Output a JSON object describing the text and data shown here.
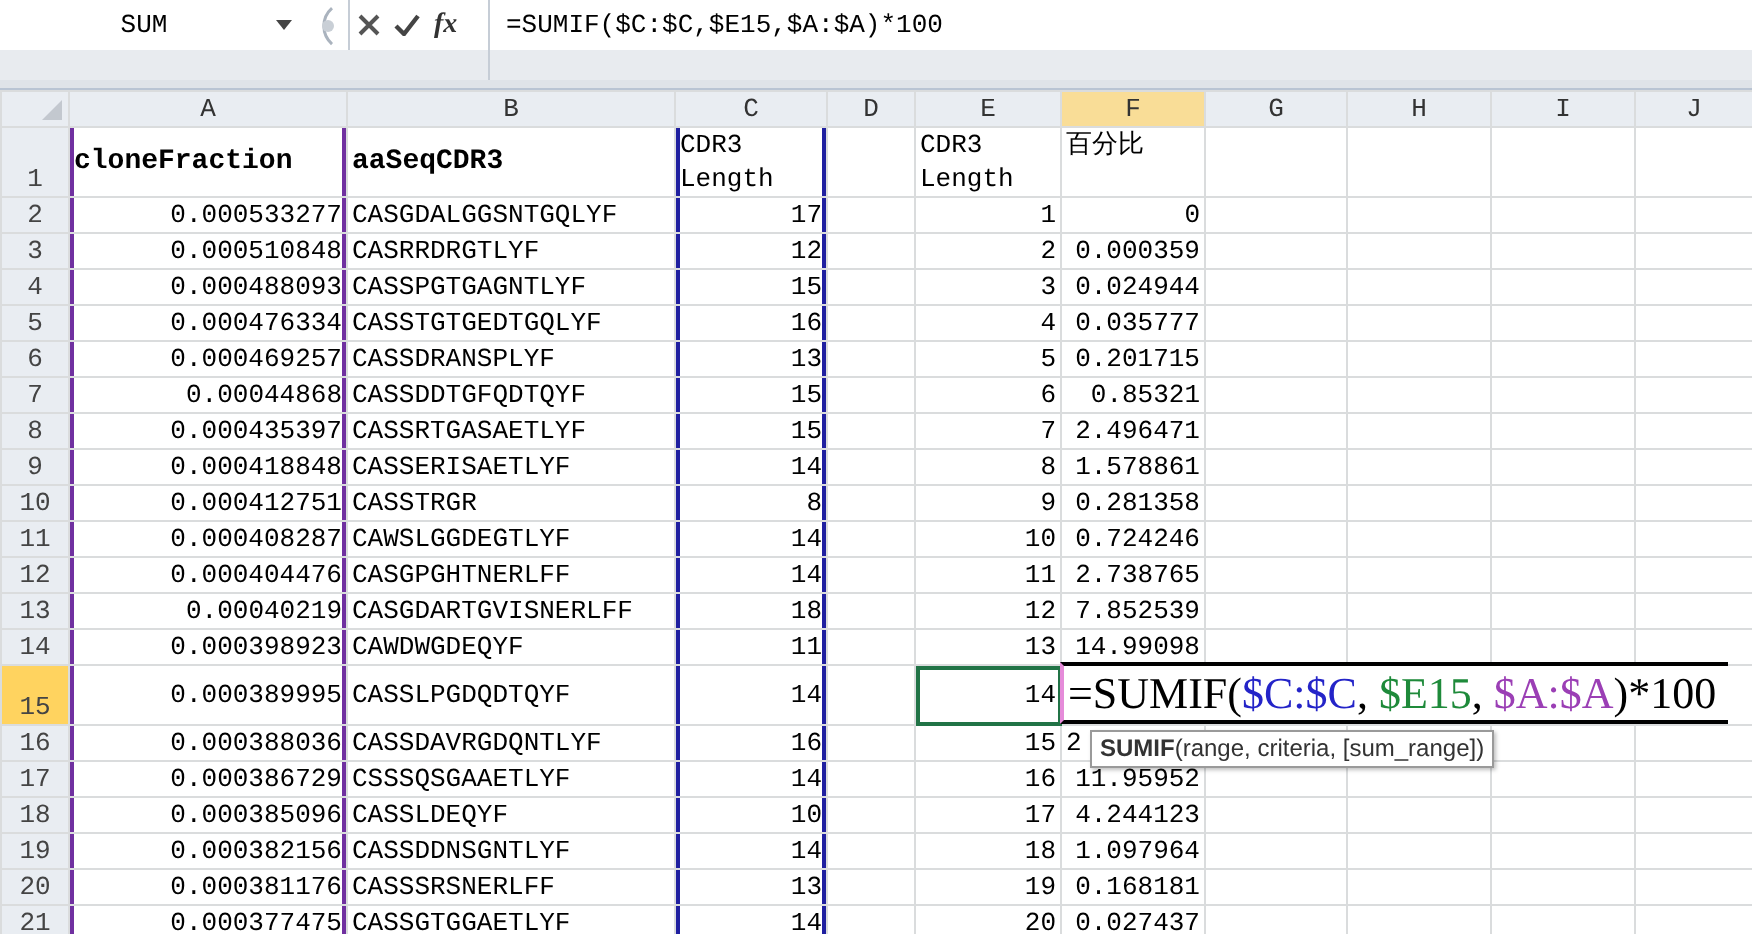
{
  "formula_bar": {
    "name_box": "SUM",
    "function_label": "fx",
    "formula": "=SUMIF($C:$C,$E15,$A:$A)*100"
  },
  "columns": [
    {
      "label": "A",
      "selected": false,
      "color": "#7030a0"
    },
    {
      "label": "B",
      "selected": false
    },
    {
      "label": "C",
      "selected": false,
      "color": "#1f1fa0"
    },
    {
      "label": "D",
      "selected": false
    },
    {
      "label": "E",
      "selected": false
    },
    {
      "label": "F",
      "selected": true
    },
    {
      "label": "G",
      "selected": false
    },
    {
      "label": "H",
      "selected": false
    },
    {
      "label": "I",
      "selected": false
    },
    {
      "label": "J",
      "selected": false
    }
  ],
  "rows": [
    {
      "number": "1",
      "selected": false,
      "cells": [
        {
          "kind": "bold",
          "text": "cloneFraction",
          "selected": false
        },
        {
          "kind": "bold",
          "text": "aaSeqCDR3",
          "selected": false
        },
        {
          "kind": "wrap",
          "text": "CDR3 Length",
          "selected": false
        },
        {
          "kind": "wrap",
          "text": "CDR3 Length",
          "selected": false
        },
        {
          "kind": "wrap",
          "text": "百分比",
          "selected": false
        }
      ]
    },
    {
      "number": "2",
      "selected": false,
      "cells": [
        {
          "kind": "number",
          "text": "0.000533277",
          "selected": false
        },
        {
          "kind": "text",
          "text": "CASGDALGGSNTGQLYF",
          "selected": false
        },
        {
          "kind": "number",
          "text": "17",
          "selected": false
        },
        {
          "kind": "number",
          "text": "1",
          "selected": false
        },
        {
          "kind": "number",
          "text": "0",
          "selected": false
        }
      ]
    },
    {
      "number": "3",
      "selected": false,
      "cells": [
        {
          "kind": "number",
          "text": "0.000510848",
          "selected": false
        },
        {
          "kind": "text",
          "text": "CASRRDRGTLYF",
          "selected": false
        },
        {
          "kind": "number",
          "text": "12",
          "selected": false
        },
        {
          "kind": "number",
          "text": "2",
          "selected": false
        },
        {
          "kind": "number",
          "text": "0.000359",
          "selected": false
        }
      ]
    },
    {
      "number": "4",
      "selected": false,
      "cells": [
        {
          "kind": "number",
          "text": "0.000488093",
          "selected": false
        },
        {
          "kind": "text",
          "text": "CASSPGTGAGNTLYF",
          "selected": false
        },
        {
          "kind": "number",
          "text": "15",
          "selected": false
        },
        {
          "kind": "number",
          "text": "3",
          "selected": false
        },
        {
          "kind": "number",
          "text": "0.024944",
          "selected": false
        }
      ]
    },
    {
      "number": "5",
      "selected": false,
      "cells": [
        {
          "kind": "number",
          "text": "0.000476334",
          "selected": false
        },
        {
          "kind": "text",
          "text": "CASSTGTGEDTGQLYF",
          "selected": false
        },
        {
          "kind": "number",
          "text": "16",
          "selected": false
        },
        {
          "kind": "number",
          "text": "4",
          "selected": false
        },
        {
          "kind": "number",
          "text": "0.035777",
          "selected": false
        }
      ]
    },
    {
      "number": "6",
      "selected": false,
      "cells": [
        {
          "kind": "number",
          "text": "0.000469257",
          "selected": false
        },
        {
          "kind": "text",
          "text": "CASSDRANSPLYF",
          "selected": false
        },
        {
          "kind": "number",
          "text": "13",
          "selected": false
        },
        {
          "kind": "number",
          "text": "5",
          "selected": false
        },
        {
          "kind": "number",
          "text": "0.201715",
          "selected": false
        }
      ]
    },
    {
      "number": "7",
      "selected": false,
      "cells": [
        {
          "kind": "number",
          "text": "0.00044868",
          "selected": false
        },
        {
          "kind": "text",
          "text": "CASSDDTGFQDTQYF",
          "selected": false
        },
        {
          "kind": "number",
          "text": "15",
          "selected": false
        },
        {
          "kind": "number",
          "text": "6",
          "selected": false
        },
        {
          "kind": "number",
          "text": "0.85321",
          "selected": false
        }
      ]
    },
    {
      "number": "8",
      "selected": false,
      "cells": [
        {
          "kind": "number",
          "text": "0.000435397",
          "selected": false
        },
        {
          "kind": "text",
          "text": "CASSRTGASAETLYF",
          "selected": false
        },
        {
          "kind": "number",
          "text": "15",
          "selected": false
        },
        {
          "kind": "number",
          "text": "7",
          "selected": false
        },
        {
          "kind": "number",
          "text": "2.496471",
          "selected": false
        }
      ]
    },
    {
      "number": "9",
      "selected": false,
      "cells": [
        {
          "kind": "number",
          "text": "0.000418848",
          "selected": false
        },
        {
          "kind": "text",
          "text": "CASSERISAETLYF",
          "selected": false
        },
        {
          "kind": "number",
          "text": "14",
          "selected": false
        },
        {
          "kind": "number",
          "text": "8",
          "selected": false
        },
        {
          "kind": "number",
          "text": "1.578861",
          "selected": false
        }
      ]
    },
    {
      "number": "10",
      "selected": false,
      "cells": [
        {
          "kind": "number",
          "text": "0.000412751",
          "selected": false
        },
        {
          "kind": "text",
          "text": "CASSTRGR",
          "selected": false
        },
        {
          "kind": "number",
          "text": "8",
          "selected": false
        },
        {
          "kind": "number",
          "text": "9",
          "selected": false
        },
        {
          "kind": "number",
          "text": "0.281358",
          "selected": false
        }
      ]
    },
    {
      "number": "11",
      "selected": false,
      "cells": [
        {
          "kind": "number",
          "text": "0.000408287",
          "selected": false
        },
        {
          "kind": "text",
          "text": "CAWSLGGDEGTLYF",
          "selected": false
        },
        {
          "kind": "number",
          "text": "14",
          "selected": false
        },
        {
          "kind": "number",
          "text": "10",
          "selected": false
        },
        {
          "kind": "number",
          "text": "0.724246",
          "selected": false
        }
      ]
    },
    {
      "number": "12",
      "selected": false,
      "cells": [
        {
          "kind": "number",
          "text": "0.000404476",
          "selected": false
        },
        {
          "kind": "text",
          "text": "CASGPGHTNERLFF",
          "selected": false
        },
        {
          "kind": "number",
          "text": "14",
          "selected": false
        },
        {
          "kind": "number",
          "text": "11",
          "selected": false
        },
        {
          "kind": "number",
          "text": "2.738765",
          "selected": false
        }
      ]
    },
    {
      "number": "13",
      "selected": false,
      "cells": [
        {
          "kind": "number",
          "text": "0.00040219",
          "selected": false
        },
        {
          "kind": "text",
          "text": "CASGDARTGVISNERLFF",
          "selected": false
        },
        {
          "kind": "number",
          "text": "18",
          "selected": false
        },
        {
          "kind": "number",
          "text": "12",
          "selected": false
        },
        {
          "kind": "number",
          "text": "7.852539",
          "selected": false
        }
      ]
    },
    {
      "number": "14",
      "selected": false,
      "cells": [
        {
          "kind": "number",
          "text": "0.000398923",
          "selected": false
        },
        {
          "kind": "text",
          "text": "CAWDWGDEQYF",
          "selected": false
        },
        {
          "kind": "number",
          "text": "11",
          "selected": false
        },
        {
          "kind": "number",
          "text": "13",
          "selected": false
        },
        {
          "kind": "number",
          "text": "14.99098",
          "selected": false
        }
      ]
    },
    {
      "number": "15",
      "selected": true,
      "cells": [
        {
          "kind": "number",
          "text": "0.000389995",
          "selected": false
        },
        {
          "kind": "text",
          "text": "CASSLPGDQDTQYF",
          "selected": false
        },
        {
          "kind": "number",
          "text": "14",
          "selected": false
        },
        {
          "kind": "number",
          "text": "14",
          "selected": true
        }
      ],
      "editor": {
        "segments": [
          {
            "text": "=SUMIF(",
            "color": "#000000"
          },
          {
            "text": "$C:$C",
            "color": "#2424c8"
          },
          {
            "text": ", ",
            "color": "#000000"
          },
          {
            "text": "$E15",
            "color": "#1e8a3a"
          },
          {
            "text": ", ",
            "color": "#000000"
          },
          {
            "text": "$A:$A",
            "color": "#9b3fb5"
          },
          {
            "text": ")*100",
            "color": "#000000"
          }
        ]
      }
    },
    {
      "number": "16",
      "selected": false,
      "cells": [
        {
          "kind": "number",
          "text": "0.000388036",
          "selected": false
        },
        {
          "kind": "text",
          "text": "CASSDAVRGDQNTLYF",
          "selected": false
        },
        {
          "kind": "number",
          "text": "16",
          "selected": false
        },
        {
          "kind": "number",
          "text": "15",
          "selected": false
        },
        {
          "kind": "left",
          "text": "2",
          "selected": false
        }
      ]
    },
    {
      "number": "17",
      "selected": false,
      "cells": [
        {
          "kind": "number",
          "text": "0.000386729",
          "selected": false
        },
        {
          "kind": "text",
          "text": "CSSSQSGAAETLYF",
          "selected": false
        },
        {
          "kind": "number",
          "text": "14",
          "selected": false
        },
        {
          "kind": "number",
          "text": "16",
          "selected": false
        },
        {
          "kind": "number",
          "text": "11.95952",
          "selected": false
        }
      ]
    },
    {
      "number": "18",
      "selected": false,
      "cells": [
        {
          "kind": "number",
          "text": "0.000385096",
          "selected": false
        },
        {
          "kind": "text",
          "text": "CASSLDEQYF",
          "selected": false
        },
        {
          "kind": "number",
          "text": "10",
          "selected": false
        },
        {
          "kind": "number",
          "text": "17",
          "selected": false
        },
        {
          "kind": "number",
          "text": "4.244123",
          "selected": false
        }
      ]
    },
    {
      "number": "19",
      "selected": false,
      "cells": [
        {
          "kind": "number",
          "text": "0.000382156",
          "selected": false
        },
        {
          "kind": "text",
          "text": "CASSDDNSGNTLYF",
          "selected": false
        },
        {
          "kind": "number",
          "text": "14",
          "selected": false
        },
        {
          "kind": "number",
          "text": "18",
          "selected": false
        },
        {
          "kind": "number",
          "text": "1.097964",
          "selected": false
        }
      ]
    },
    {
      "number": "20",
      "selected": false,
      "cells": [
        {
          "kind": "number",
          "text": "0.000381176",
          "selected": false
        },
        {
          "kind": "text",
          "text": "CASSSRSNERLFF",
          "selected": false
        },
        {
          "kind": "number",
          "text": "13",
          "selected": false
        },
        {
          "kind": "number",
          "text": "19",
          "selected": false
        },
        {
          "kind": "number",
          "text": "0.168181",
          "selected": false
        }
      ]
    },
    {
      "number": "21",
      "selected": false,
      "cells": [
        {
          "kind": "number",
          "text": "0.000377475",
          "selected": false
        },
        {
          "kind": "text",
          "text": "CASSGTGGAETLYF",
          "selected": false
        },
        {
          "kind": "number",
          "text": "14",
          "selected": false
        },
        {
          "kind": "number",
          "text": "20",
          "selected": false
        },
        {
          "kind": "number",
          "text": "0.027437",
          "selected": false
        }
      ]
    }
  ],
  "tooltip": "**SUMIF**(range, criteria, [sum_range])"
}
